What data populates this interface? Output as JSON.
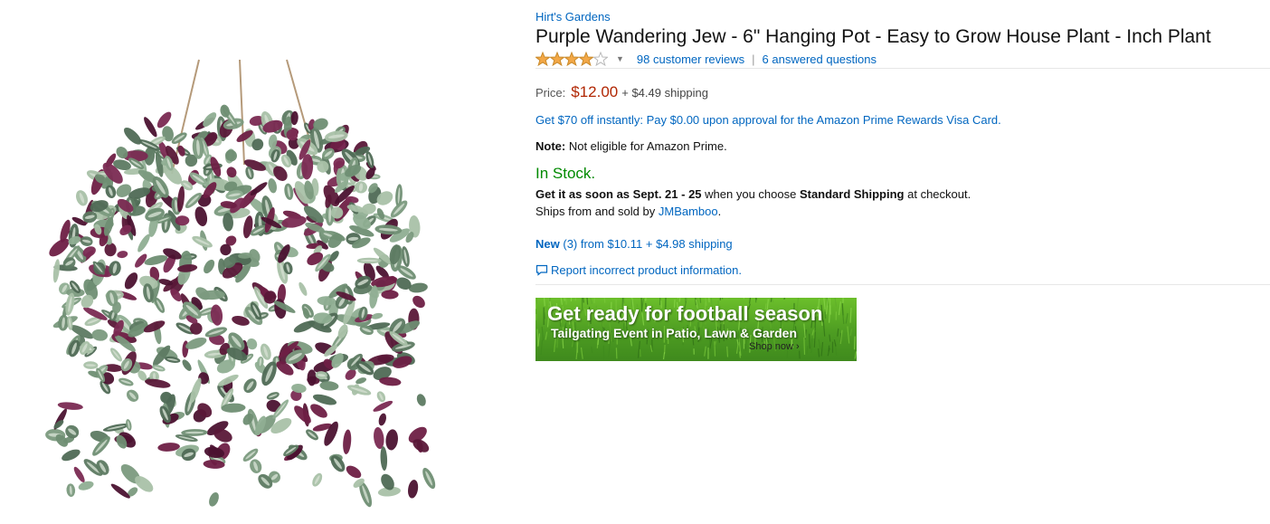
{
  "product": {
    "brand": "Hirt's Gardens",
    "title": "Purple Wandering Jew - 6\" Hanging Pot - Easy to Grow House Plant - Inch Plant",
    "rating": 4,
    "rating_max": 5,
    "reviews_link": "98 customer reviews",
    "rating_separator": "|",
    "questions_link": "6 answered questions"
  },
  "pricing": {
    "label": "Price:",
    "price": "$12.00",
    "shipping": "+ $4.49 shipping"
  },
  "promo": {
    "text": "Get $70 off instantly: Pay $0.00 upon approval for the Amazon Prime Rewards Visa Card."
  },
  "note": {
    "label": "Note:",
    "text": " Not eligible for Amazon Prime."
  },
  "availability": {
    "status": "In Stock.",
    "status_color": "#008a00",
    "delivery_prefix": "Get it as soon as ",
    "delivery_dates": "Sept. 21 - 25",
    "delivery_mid": " when you choose ",
    "delivery_method": "Standard Shipping",
    "delivery_suffix": " at checkout.",
    "ships_prefix": "Ships from and sold by ",
    "seller": "JMBamboo",
    "ships_suffix": "."
  },
  "offers": {
    "condition": "New",
    "count": "(3)",
    "from_text": " from $10.11 + $4.98 shipping"
  },
  "report": {
    "icon": "comment-icon",
    "text": "Report incorrect product information."
  },
  "banner": {
    "title": "Get ready for football season",
    "subtitle": "Tailgating Event in Patio, Lawn & Garden",
    "cta": "Shop now ›"
  },
  "colors": {
    "link": "#0066c0",
    "price": "#b12704",
    "star": "#f3a847"
  }
}
